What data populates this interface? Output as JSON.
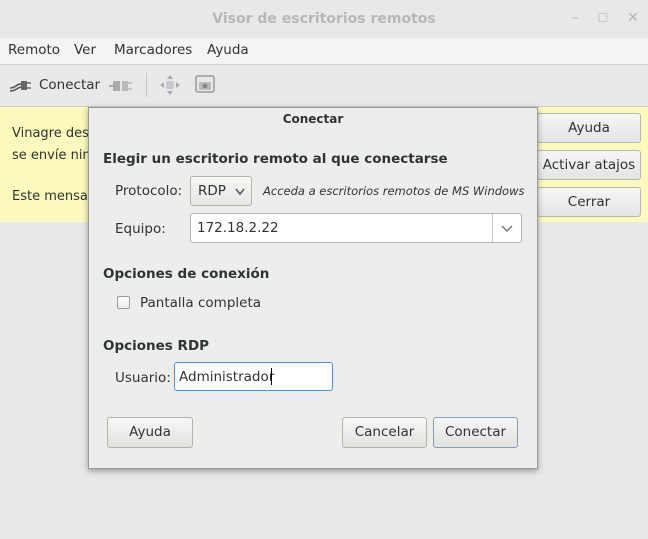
{
  "window": {
    "title": "Visor de escritorios remotos"
  },
  "menu": [
    "Remoto",
    "Ver",
    "Marcadores",
    "Ayuda"
  ],
  "toolbar": {
    "connect_label": "Conectar"
  },
  "infobar": {
    "line1": "Vinagre des",
    "line2": "se envíe nin",
    "line3": "Este mensa",
    "buttons": [
      "Ayuda",
      "Activar atajos",
      "Cerrar"
    ]
  },
  "dialog": {
    "title": "Conectar",
    "section_remote": "Elegir un escritorio remoto al que conectarse",
    "protocol_label": "Protocolo:",
    "protocol_value": "RDP",
    "protocol_desc": "Acceda a escritorios remotos de MS Windows",
    "host_label": "Equipo:",
    "host_value": "172.18.2.22",
    "section_conn": "Opciones de conexión",
    "fullscreen_label": "Pantalla completa",
    "section_rdp": "Opciones RDP",
    "user_label": "Usuario:",
    "user_value": "Administrador",
    "help_button": "Ayuda",
    "cancel_button": "Cancelar",
    "connect_button": "Conectar"
  }
}
